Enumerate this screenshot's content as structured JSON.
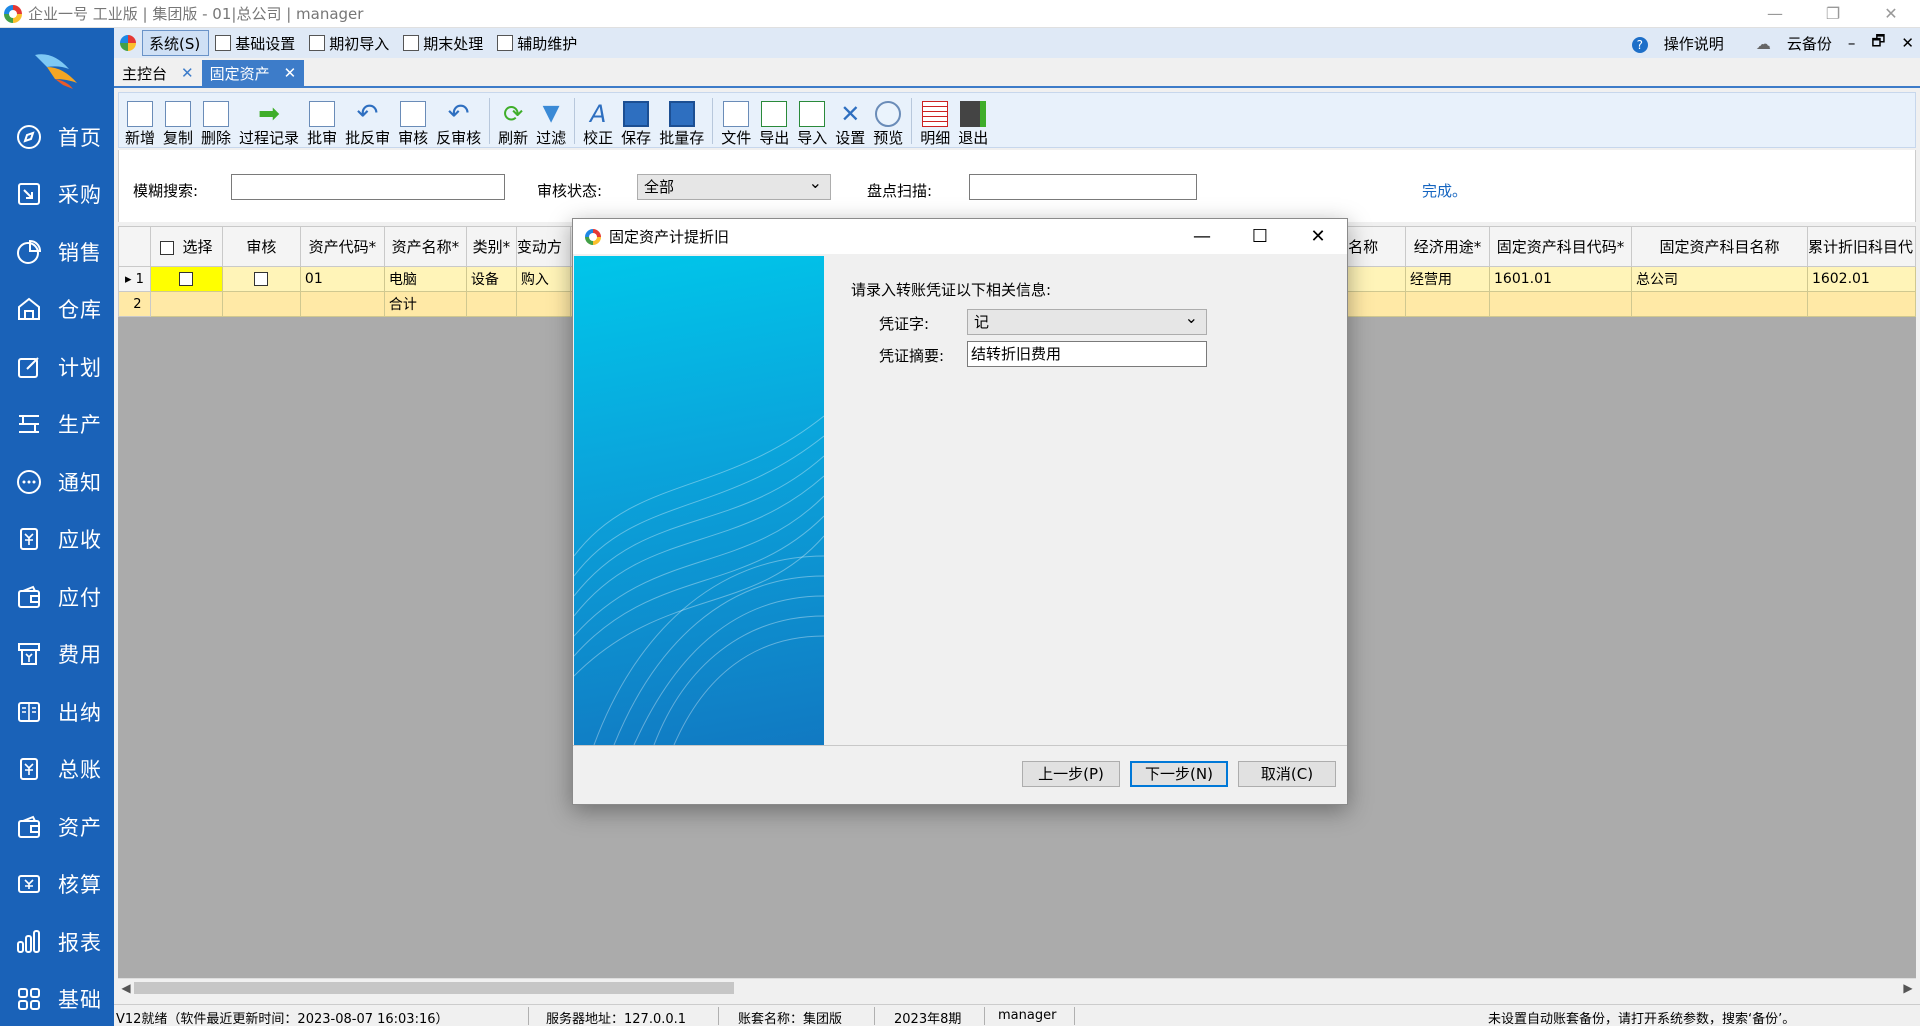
{
  "window": {
    "title": "企业一号 工业版 | 集团版 - 01|总公司 | manager",
    "controls": [
      "—",
      "❐",
      "✕"
    ]
  },
  "sidebar": {
    "items": [
      {
        "label": "首页",
        "icon": "compass-icon"
      },
      {
        "label": "采购",
        "icon": "purchase-icon"
      },
      {
        "label": "销售",
        "icon": "pie-chart-icon"
      },
      {
        "label": "仓库",
        "icon": "warehouse-icon"
      },
      {
        "label": "计划",
        "icon": "edit-icon"
      },
      {
        "label": "生产",
        "icon": "production-icon"
      },
      {
        "label": "通知",
        "icon": "chat-icon"
      },
      {
        "label": "应收",
        "icon": "receivable-icon"
      },
      {
        "label": "应付",
        "icon": "wallet-icon"
      },
      {
        "label": "费用",
        "icon": "expense-icon"
      },
      {
        "label": "出纳",
        "icon": "cashier-icon"
      },
      {
        "label": "总账",
        "icon": "ledger-icon"
      },
      {
        "label": "资产",
        "icon": "asset-icon"
      },
      {
        "label": "核算",
        "icon": "accounting-icon"
      },
      {
        "label": "报表",
        "icon": "bar-chart-icon"
      },
      {
        "label": "基础",
        "icon": "grid-icon"
      }
    ]
  },
  "menubar": {
    "items": [
      "系统(S)",
      "基础设置",
      "期初导入",
      "期末处理",
      "辅助维护"
    ],
    "help": "操作说明",
    "backup": "云备份",
    "controls": [
      "–",
      "🗗",
      "✕"
    ]
  },
  "tabs": [
    {
      "label": "主控台",
      "close": "✕"
    },
    {
      "label": "固定资产",
      "close": "✕"
    }
  ],
  "toolbar": {
    "buttons": [
      "新增",
      "复制",
      "删除",
      "过程记录",
      "批审",
      "批反审",
      "审核",
      "反审核",
      "刷新",
      "过滤",
      "校正",
      "保存",
      "批量存",
      "文件",
      "导出",
      "导入",
      "设置",
      "预览",
      "明细",
      "退出"
    ]
  },
  "filter": {
    "search_label": "模糊搜索:",
    "search_value": "",
    "status_label": "审核状态:",
    "status_value": "全部",
    "scan_label": "盘点扫描:",
    "scan_value": "",
    "done": "完成。"
  },
  "grid": {
    "left_headers": [
      "选择",
      "审核",
      "资产代码*",
      "资产名称*",
      "类别*",
      "变动方"
    ],
    "right_headers": [
      "名称",
      "经济用途*",
      "固定资产科目代码*",
      "固定资产科目名称",
      "累计折旧科目代"
    ],
    "rows": [
      {
        "num": "1",
        "code": "01",
        "name": "电脑",
        "category": "设备",
        "change": "购入",
        "use": "经营用",
        "acct_code": "1601.01",
        "acct_name": "总公司",
        "dep_code": "1602.01"
      },
      {
        "num": "2",
        "code": "",
        "name": "合计",
        "category": "",
        "change": "",
        "use": "",
        "acct_code": "",
        "acct_name": "",
        "dep_code": ""
      }
    ]
  },
  "statusbar": {
    "ready": "V12就绪（软件最近更新时间：2023-08-07 16:03:16）",
    "server": "服务器地址：127.0.0.1",
    "book": "账套名称：集团版",
    "period": "2023年8期",
    "user": "manager",
    "notice": "未设置自动账套备份，请打开系统参数，搜索‘备份’。"
  },
  "dialog": {
    "title": "固定资产计提折旧",
    "controls": [
      "—",
      "☐",
      "✕"
    ],
    "prompt": "请录入转账凭证以下相关信息:",
    "voucher_label": "凭证字:",
    "voucher_value": "记",
    "summary_label": "凭证摘要:",
    "summary_value": "结转折旧费用",
    "prev": "上一步(P)",
    "next": "下一步(N)",
    "cancel": "取消(C)"
  },
  "colors": {
    "sidebar": "#1a62b8",
    "tab_active": "#3d7cc9",
    "row_highlight": "#fff4b8",
    "selected_cell": "#ffff00",
    "banner": "#0aa6dc"
  }
}
